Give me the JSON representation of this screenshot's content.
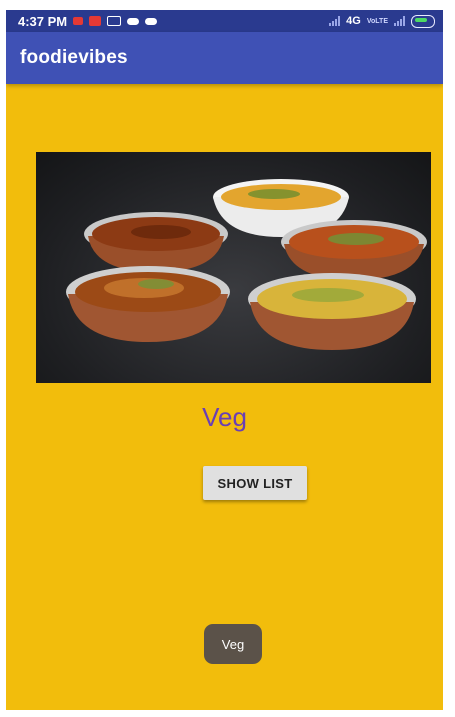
{
  "status_bar": {
    "time": "4:37 PM",
    "network": "4G",
    "carrier_badge": "VoLTE",
    "notifications": [
      "gmail-icon",
      "youtube-icon",
      "message-icon",
      "cloud-icon",
      "cloud-icon"
    ]
  },
  "app_bar": {
    "title": "foodievibes"
  },
  "content": {
    "category_title": "Veg",
    "show_list_label": "SHOW LIST"
  },
  "toast": {
    "text": "Veg"
  },
  "colors": {
    "status_bar": "#2A3A8F",
    "app_bar": "#3F51B5",
    "background": "#F2BD0C",
    "title_text": "#6A3FB5",
    "button": "#E0E0E0",
    "toast": "#5B5249"
  }
}
